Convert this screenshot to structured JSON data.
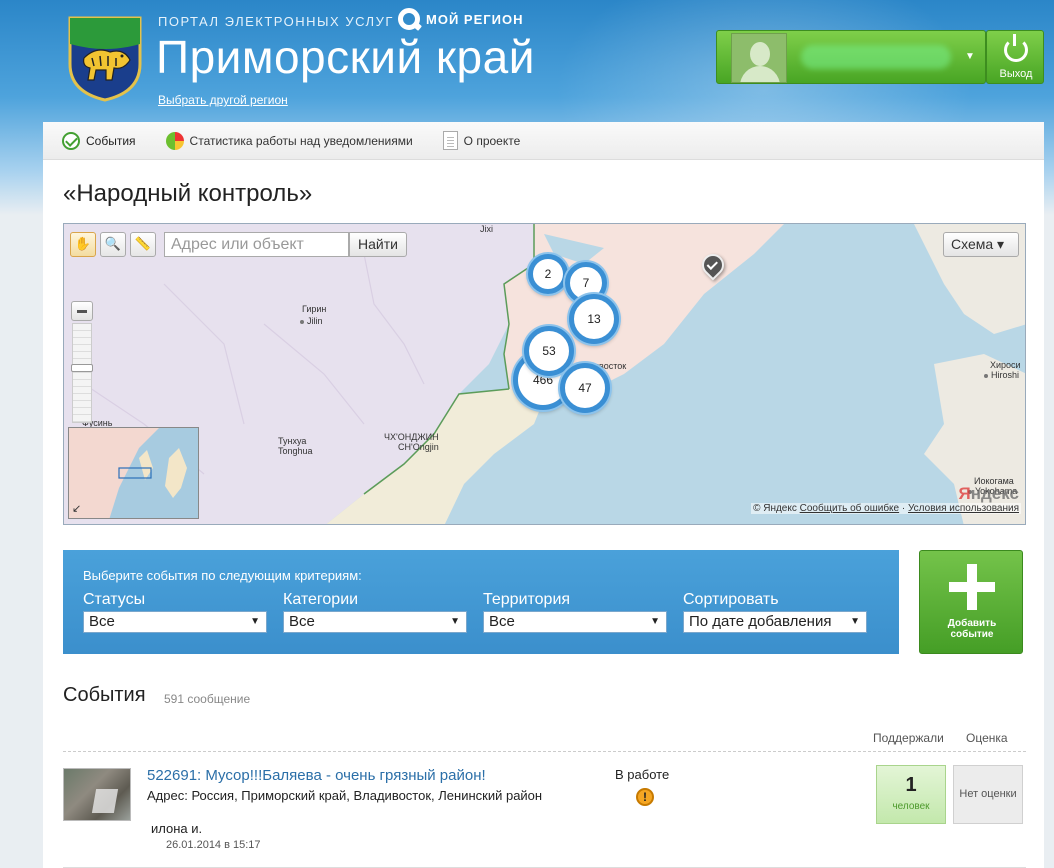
{
  "header": {
    "portal_label": "ПОРТАЛ ЭЛЕКТРОННЫХ УСЛУГ",
    "brand": "МОЙ РЕГИОН",
    "region_title": "Приморский край",
    "change_region_link": "Выбрать другой регион",
    "user_name": "",
    "logout_label": "Выход",
    "colors": {
      "header_blue": "#2b86c8",
      "user_green": "#48a524"
    }
  },
  "nav": {
    "items": [
      {
        "label": "События",
        "icon": "check-circle-icon",
        "active": true
      },
      {
        "label": "Статистика работы над уведомлениями",
        "icon": "pie-chart-icon"
      },
      {
        "label": "О проекте",
        "icon": "document-icon"
      }
    ]
  },
  "page_title": "«Народный контроль»",
  "map": {
    "search_placeholder": "Адрес или объект",
    "search_button": "Найти",
    "map_type": "Схема ▾",
    "tools": [
      "hand-icon",
      "zoom-area-icon",
      "ruler-icon"
    ],
    "clusters": [
      {
        "count": "2"
      },
      {
        "count": "7"
      },
      {
        "count": "13"
      },
      {
        "count": "53"
      },
      {
        "count": "466"
      },
      {
        "count": "47"
      }
    ],
    "cities": {
      "jixi": "Jixi",
      "girin": "Гирин",
      "jilin": "Jilin",
      "tunhua": "Тунхуа",
      "tonghua": "Tonghua",
      "chongjin": "ЧХ'ОНДЖИН",
      "chongjin_en": "CH'Ongjin",
      "pusin": "Фусинь",
      "vladivostok": "ивосток",
      "hiroshima": "Хироси",
      "hiroshima_en": "Hiroshi",
      "yokohama": "Иокогама",
      "yokohama_en": "Yokohama"
    },
    "copyright": "© Яндекс",
    "report_error": "Сообщить об ошибке",
    "terms": "Условия использования",
    "yandex_y": "Я",
    "yandex_rest": "ндекс"
  },
  "filters": {
    "caption": "Выберите события по следующим критериям:",
    "statuses": {
      "label": "Статусы",
      "value": "Все"
    },
    "categories": {
      "label": "Категории",
      "value": "Все"
    },
    "territory": {
      "label": "Территория",
      "value": "Все"
    },
    "sort": {
      "label": "Сортировать",
      "value": "По дате добавления"
    },
    "add_button_line1": "Добавить",
    "add_button_line2": "событие"
  },
  "events": {
    "title": "События",
    "count": "591 сообщение",
    "col_supported": "Поддержали",
    "col_rating": "Оценка",
    "items": [
      {
        "title": "522691: Мусор!!!Баляева - очень грязный район!",
        "address": "Адрес: Россия, Приморский край, Владивосток, Ленинский район",
        "author": "илона и.",
        "date": "26.01.2014 в 15:17",
        "status": "В работе",
        "supported_count": "1",
        "supported_unit": "человек",
        "rating": "Нет оценки"
      }
    ]
  }
}
